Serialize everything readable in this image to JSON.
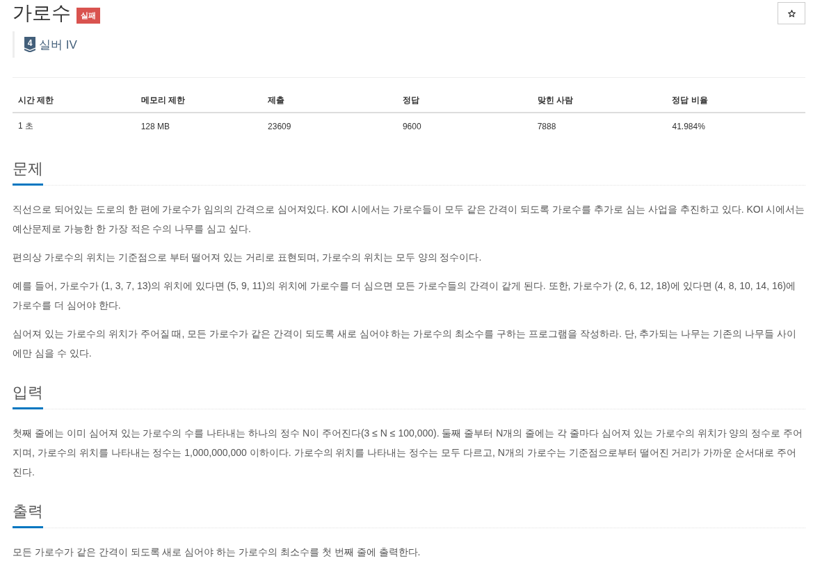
{
  "problem": {
    "title": "가로수",
    "result_badge": "실패",
    "tier": {
      "number": "4",
      "name": "실버 IV"
    }
  },
  "stats_table": {
    "columns": [
      "시간 제한",
      "메모리 제한",
      "제출",
      "정답",
      "맞힌 사람",
      "정답 비율"
    ],
    "rows": [
      [
        "1 초",
        "128 MB",
        "23609",
        "9600",
        "7888",
        "41.984%"
      ]
    ]
  },
  "sections": [
    {
      "heading": "문제",
      "paragraphs": [
        "직선으로 되어있는 도로의 한 편에 가로수가 임의의 간격으로 심어져있다. KOI 시에서는 가로수들이 모두 같은 간격이 되도록 가로수를 추가로 심는 사업을 추진하고 있다. KOI 시에서는 예산문제로 가능한 한 가장 적은 수의 나무를 심고 싶다.",
        "편의상 가로수의 위치는 기준점으로 부터 떨어져 있는 거리로 표현되며, 가로수의 위치는 모두 양의 정수이다.",
        "예를 들어, 가로수가 (1, 3, 7, 13)의 위치에 있다면 (5, 9, 11)의 위치에 가로수를 더 심으면 모든 가로수들의 간격이 같게 된다. 또한, 가로수가 (2, 6, 12, 18)에 있다면 (4, 8, 10, 14, 16)에 가로수를 더 심어야 한다.",
        "심어져 있는 가로수의 위치가 주어질 때, 모든 가로수가 같은 간격이 되도록 새로 심어야 하는 가로수의 최소수를 구하는 프로그램을 작성하라. 단, 추가되는 나무는 기존의 나무들 사이에만 심을 수 있다."
      ]
    },
    {
      "heading": "입력",
      "paragraphs": [
        "첫째 줄에는 이미 심어져 있는 가로수의 수를 나타내는 하나의 정수 N이 주어진다(3 ≤ N ≤ 100,000). 둘째 줄부터 N개의 줄에는 각 줄마다 심어져 있는 가로수의 위치가 양의 정수로 주어지며, 가로수의 위치를 나타내는 정수는 1,000,000,000 이하이다. 가로수의 위치를 나타내는 정수는 모두 다르고, N개의 가로수는 기준점으로부터 떨어진 거리가 가까운 순서대로 주어진다."
      ]
    },
    {
      "heading": "출력",
      "paragraphs": [
        "모든 가로수가 같은 간격이 되도록 새로 심어야 하는 가로수의 최소수를 첫 번째 줄에 출력한다."
      ]
    }
  ]
}
